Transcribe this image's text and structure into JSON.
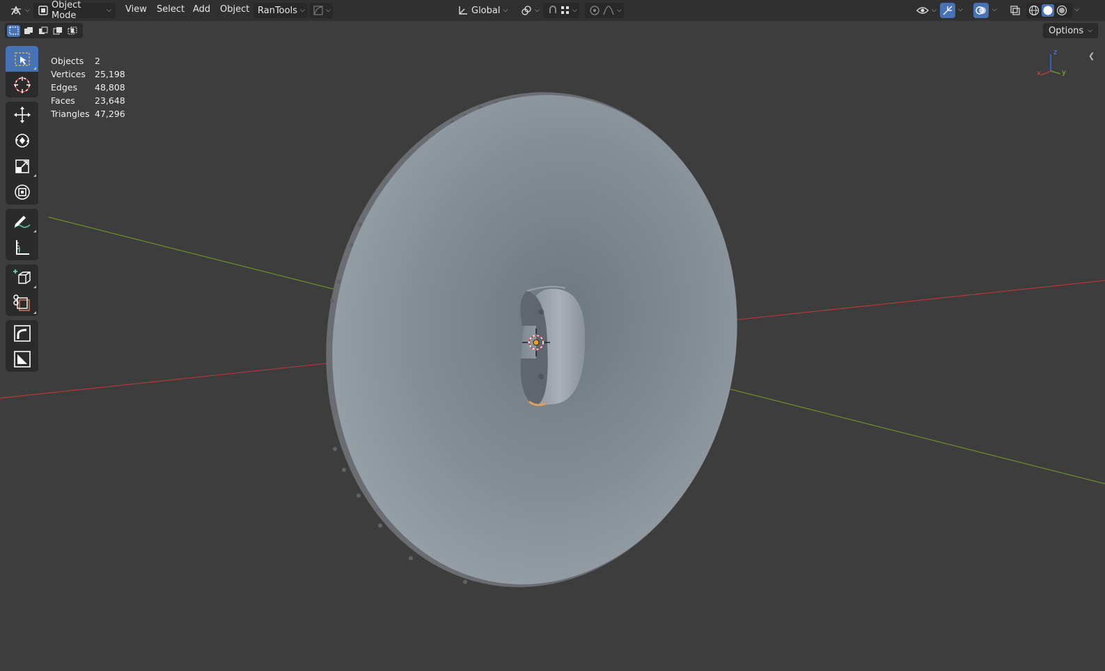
{
  "header": {
    "mode_label": "Object Mode",
    "menu": {
      "view": "View",
      "select": "Select",
      "add": "Add",
      "object": "Object",
      "rantools": "RanTools"
    },
    "transform_orientation": "Global"
  },
  "subheader": {
    "options_label": "Options"
  },
  "statistics": {
    "rows": [
      {
        "label": "Objects",
        "value": "2"
      },
      {
        "label": "Vertices",
        "value": "25,198"
      },
      {
        "label": "Edges",
        "value": "48,808"
      },
      {
        "label": "Faces",
        "value": "23,648"
      },
      {
        "label": "Triangles",
        "value": "47,296"
      }
    ]
  },
  "gizmo": {
    "z": "z",
    "x": "x",
    "y": "y"
  },
  "colors": {
    "accent": "#4772b3",
    "background": "#3d3d3d",
    "header": "#303030",
    "axis_x": "#b8363a",
    "axis_y": "#6b8f2a",
    "axis_z": "#2f6fd1"
  },
  "tools": [
    "select-box-icon",
    "cursor-icon",
    "move-icon",
    "rotate-icon",
    "scale-icon",
    "transform-icon",
    "annotate-icon",
    "measure-icon",
    "add-cube-icon",
    "shear-cut-icon",
    "curve-tool-icon",
    "shade-tool-icon"
  ]
}
